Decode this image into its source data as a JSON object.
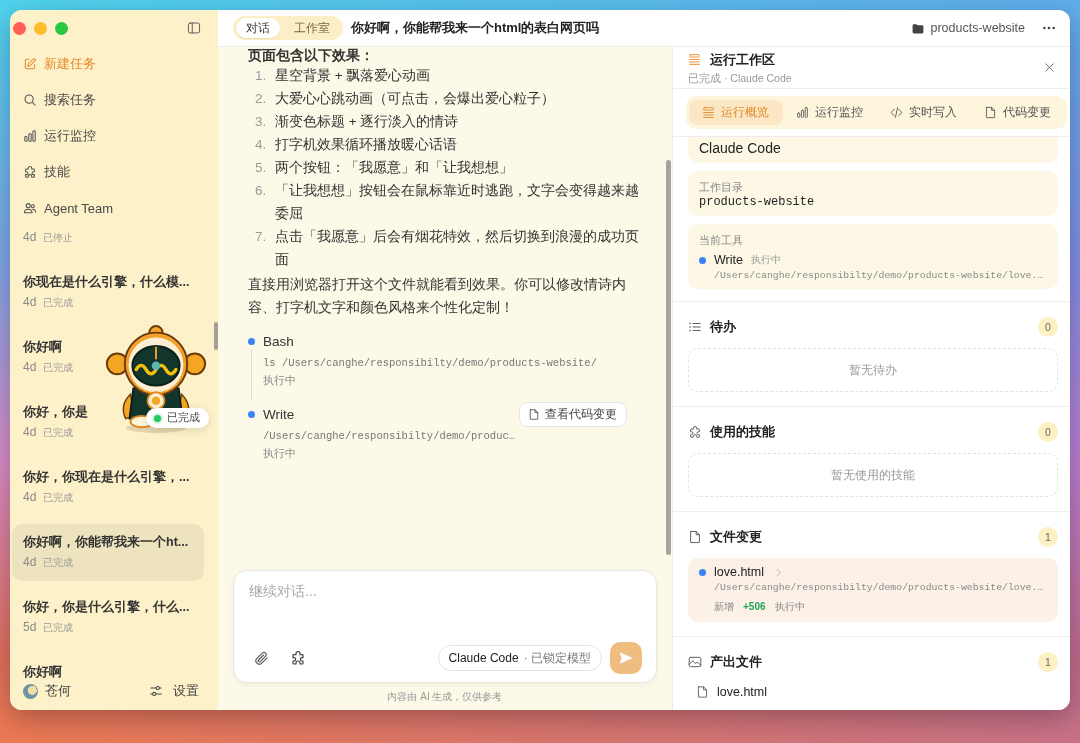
{
  "sidebar": {
    "nav": [
      {
        "kind": "compose",
        "label": "新建任务"
      },
      {
        "kind": "search",
        "label": "搜索任务"
      },
      {
        "kind": "monitor",
        "label": "运行监控"
      },
      {
        "kind": "skills",
        "label": "技能"
      },
      {
        "kind": "team",
        "label": "Agent Team"
      }
    ],
    "tasks": [
      {
        "age": "4d",
        "status": "已停止",
        "selected": false
      },
      {
        "title": "你现在是什么引擎，什么模...",
        "age": "4d",
        "status": "已完成",
        "selected": false
      },
      {
        "title": "你好啊",
        "age": "4d",
        "status": "已完成",
        "selected": false
      },
      {
        "title": "你好，你是",
        "age": "4d",
        "status": "已完成",
        "selected": false
      },
      {
        "title": "你好，你现在是什么引擎，...",
        "age": "4d",
        "status": "已完成",
        "selected": false
      },
      {
        "title": "你好啊，你能帮我来一个ht...",
        "age": "4d",
        "status": "已完成",
        "selected": true
      },
      {
        "title": "你好，你是什么引擎，什么...",
        "age": "5d",
        "status": "已完成",
        "selected": false
      },
      {
        "title": "你好啊",
        "selected": false
      }
    ],
    "user": {
      "name": "苍何"
    },
    "settings": {
      "label": "设置"
    }
  },
  "mascot": {
    "status": "已完成"
  },
  "topbar": {
    "modes": [
      {
        "label": "对话",
        "selected": true
      },
      {
        "label": "工作室",
        "selected": false
      }
    ],
    "title": "你好啊，你能帮我来一个html的表白网页吗",
    "project": "products-website"
  },
  "chat": {
    "heading": "页面包含以下效果：",
    "features": [
      {
        "number": "1.",
        "text": "星空背景 + 飘落爱心动画"
      },
      {
        "number": "2.",
        "text": "大爱心心跳动画（可点击，会爆出爱心粒子）"
      },
      {
        "number": "3.",
        "text": "渐变色标题 + 逐行淡入的情诗"
      },
      {
        "number": "4.",
        "text": "打字机效果循环播放暖心话语"
      },
      {
        "number": "5.",
        "text": "两个按钮：「我愿意」和「让我想想」"
      },
      {
        "number": "6.",
        "text": "「让我想想」按钮会在鼠标靠近时逃跑，文字会变得越来越委屈"
      },
      {
        "number": "7.",
        "text": "点击「我愿意」后会有烟花特效，然后切换到浪漫的成功页面"
      }
    ],
    "summary": "直接用浏览器打开这个文件就能看到效果。你可以修改情诗内容、打字机文字和颜色风格来个性化定制！",
    "tools": [
      {
        "name": "Bash",
        "detail": "ls /Users/canghe/responsibilty/demo/products-website/",
        "status": "执行中"
      },
      {
        "name": "Write",
        "detail": "/Users/canghe/responsibilty/demo/produc…",
        "status": "执行中",
        "action": "查看代码变更"
      }
    ]
  },
  "composer": {
    "placeholder": "继续对话...",
    "model": "Claude Code",
    "model_note": "· 已锁定模型"
  },
  "disclaimer": "内容由 AI 生成，仅供参考",
  "workspace": {
    "title": "运行工作区",
    "subtitle": "已完成 · Claude Code",
    "tabs": [
      {
        "kind": "overview",
        "label": "运行概览",
        "selected": true
      },
      {
        "kind": "monitor",
        "label": "运行监控",
        "selected": false
      },
      {
        "kind": "code",
        "label": "实时写入",
        "selected": false
      },
      {
        "kind": "file",
        "label": "代码变更",
        "selected": false
      }
    ],
    "details": [
      {
        "kind": "text",
        "value": "Claude Code"
      },
      {
        "kind": "path",
        "label": "工作目录",
        "value": "products-website"
      }
    ],
    "current_tool": {
      "label": "当前工具",
      "name": "Write",
      "status": "执行中",
      "path": "/Users/canghe/responsibilty/demo/products-website/love.…"
    },
    "sections": [
      {
        "kind": "todo",
        "title": "待办",
        "count": "0",
        "empty": "暂无待办"
      },
      {
        "kind": "skills",
        "title": "使用的技能",
        "count": "0",
        "empty": "暂无使用的技能"
      },
      {
        "kind": "changes",
        "title": "文件变更",
        "count": "1",
        "files": [
          {
            "name": "love.html",
            "path": "/Users/canghe/responsibilty/demo/products-website/love.…",
            "change": "新增",
            "added": "+506",
            "status": "执行中"
          }
        ]
      },
      {
        "kind": "outputs",
        "title": "产出文件",
        "count": "1",
        "files": [
          {
            "name": "love.html"
          }
        ]
      }
    ]
  }
}
